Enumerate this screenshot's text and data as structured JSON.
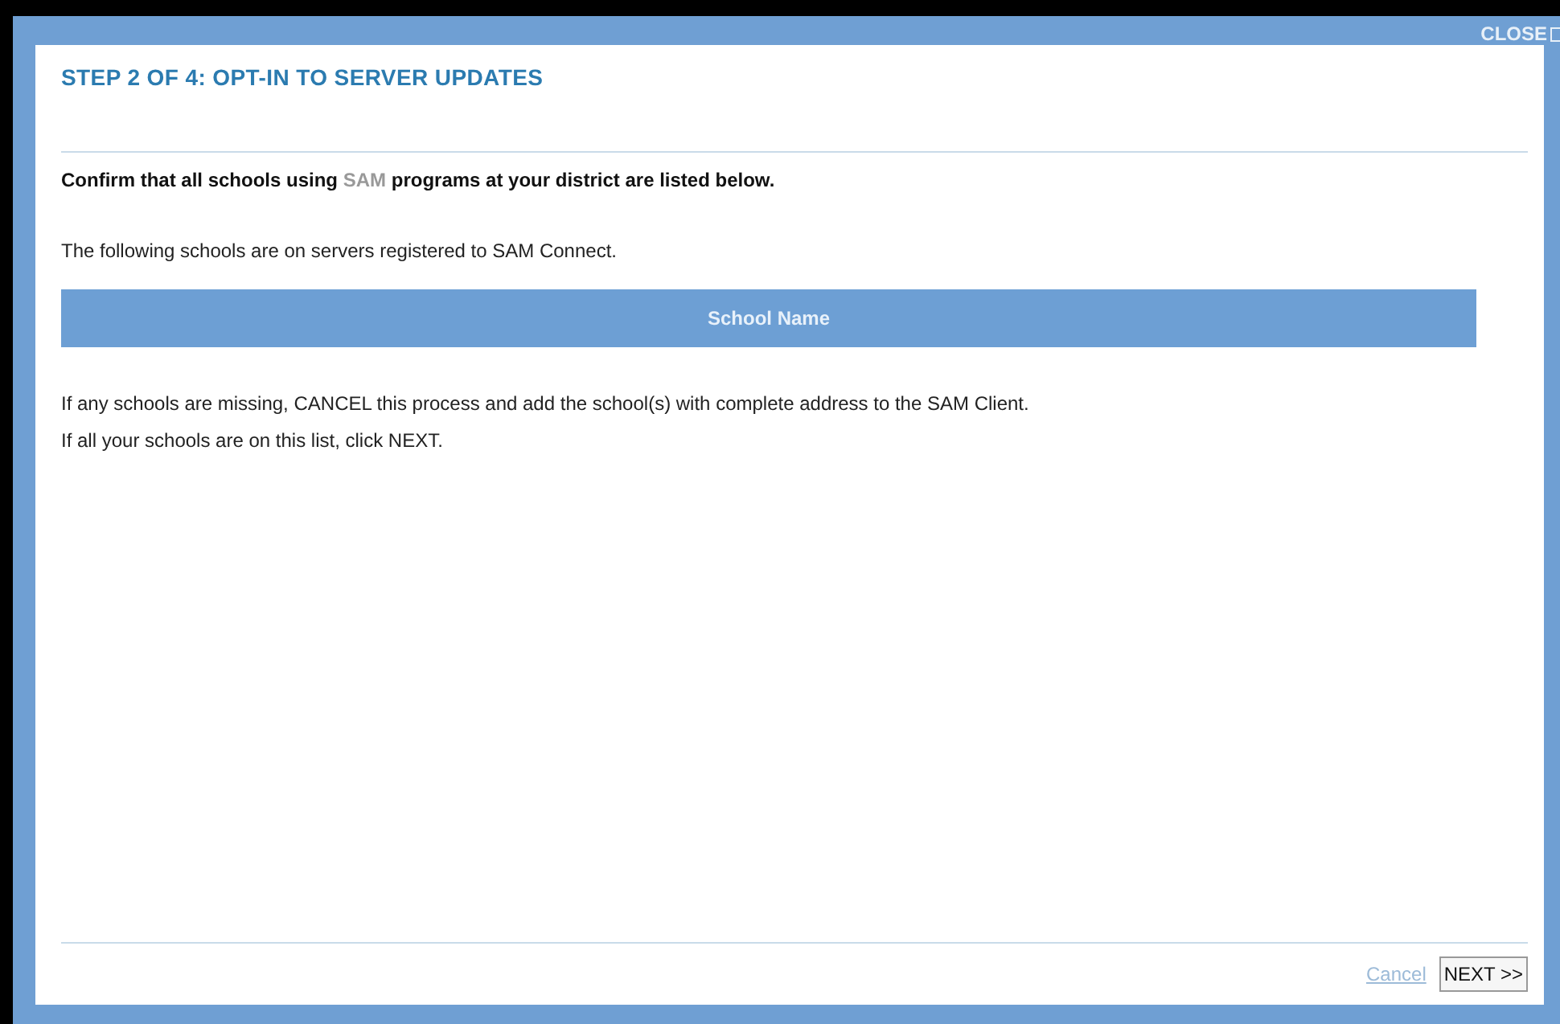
{
  "dialog": {
    "close_label": "CLOSE",
    "title": "STEP 2 OF 4: OPT-IN TO SERVER UPDATES",
    "intro": [
      {
        "text": "Confirm that all schools using ",
        "kind": "plain"
      },
      {
        "text": "SAM",
        "kind": "faded"
      },
      {
        "text": " programs at your district are listed below.",
        "kind": "plain"
      }
    ],
    "note": "The following schools are on servers registered to SAM Connect.",
    "table": {
      "columns": [
        "School Name"
      ]
    },
    "instructions": [
      "If any schools are missing, CANCEL this process and add the school(s) with complete address to the SAM Client.",
      "If all your schools are on this list, click NEXT."
    ],
    "buttons": [
      {
        "label": "Cancel",
        "kind": "link"
      },
      {
        "label": "NEXT >>",
        "kind": "button"
      }
    ]
  }
}
